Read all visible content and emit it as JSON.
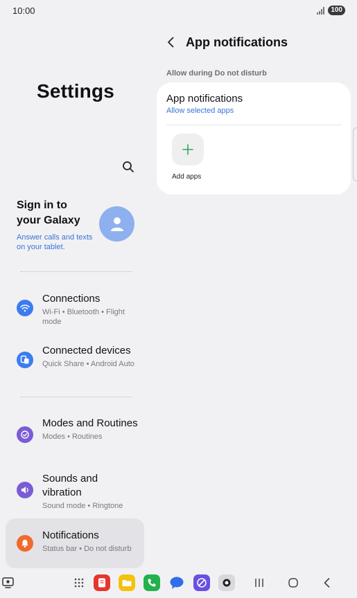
{
  "status_bar": {
    "time": "10:00",
    "battery": "100"
  },
  "left_pane": {
    "title": "Settings",
    "search_icon": "search-icon",
    "account": {
      "title": "Sign in to your Galaxy",
      "subtitle": "Answer calls and texts on your tablet."
    },
    "items": [
      {
        "label": "Connections",
        "sub": "Wi-Fi • Bluetooth • Flight mode",
        "icon": "wifi-icon",
        "color": "#3b7cf0"
      },
      {
        "label": "Connected devices",
        "sub": "Quick Share • Android Auto",
        "icon": "devices-icon",
        "color": "#3b7cf0"
      },
      {
        "label": "Modes and Routines",
        "sub": "Modes • Routines",
        "icon": "routines-icon",
        "color": "#7b5cd6"
      },
      {
        "label": "Sounds and vibration",
        "sub": "Sound mode • Ringtone",
        "icon": "speaker-icon",
        "color": "#7b5cd6"
      },
      {
        "label": "Notifications",
        "sub": "Status bar • Do not disturb",
        "icon": "bell-icon",
        "color": "#ef6a2e"
      }
    ]
  },
  "right_pane": {
    "title": "App notifications",
    "section_header": "Allow during Do not disturb",
    "card": {
      "title": "App notifications",
      "subtitle": "Allow selected apps",
      "add_label": "Add apps"
    }
  },
  "colors": {
    "background": "#f1f1f4",
    "link": "#3a74d6",
    "add_plus": "#2aa65b"
  },
  "taskbar": {
    "apps": [
      "screen-recorder-icon",
      "apps-grid-icon",
      "notes-icon",
      "files-icon",
      "phone-icon",
      "messages-icon",
      "browser-icon",
      "camera-icon"
    ],
    "nav": [
      "recents-icon",
      "home-icon",
      "back-icon"
    ]
  }
}
